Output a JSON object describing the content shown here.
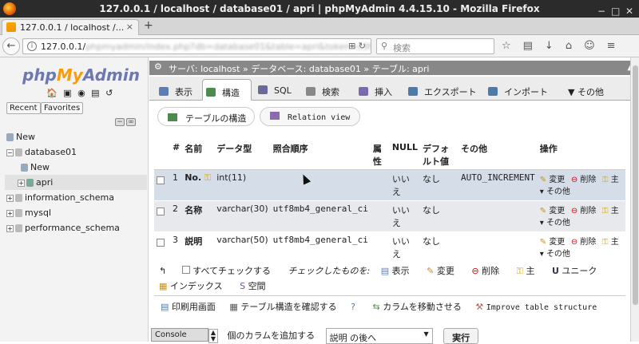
{
  "window": {
    "title": "127.0.0.1 / localhost / database01 / apri | phpMyAdmin 4.4.15.10 - Mozilla Firefox",
    "min": "−",
    "max": "□",
    "close": "✕"
  },
  "browser": {
    "tab_title": "127.0.0.1 / localhost /...",
    "tab_close": "×",
    "new_tab": "+",
    "url_host": "127.0.0.1/",
    "url_rest": "phpmyadmin/index.php?db=database01&table=apri&token=c3f4b1",
    "search_placeholder": "検索",
    "url_icons": "⊞  ↻"
  },
  "sidebar": {
    "logo_php": "php",
    "logo_my": "My",
    "logo_admin": "Admin",
    "icons": "🏠 ▣ ◉ ▤ ↺",
    "recent": "Recent",
    "favorites": "Favorites",
    "tree": [
      {
        "label": "New",
        "level": 0,
        "expander": ""
      },
      {
        "label": "database01",
        "level": 0,
        "expander": "−"
      },
      {
        "label": "New",
        "level": 1,
        "expander": ""
      },
      {
        "label": "apri",
        "level": 1,
        "expander": "+"
      },
      {
        "label": "information_schema",
        "level": 0,
        "expander": "+"
      },
      {
        "label": "mysql",
        "level": 0,
        "expander": "+"
      },
      {
        "label": "performance_schema",
        "level": 0,
        "expander": "+"
      }
    ]
  },
  "breadcrumb": {
    "server": "サーバ: localhost",
    "db": "データベース: database01",
    "table": "テーブル: apri",
    "sep": "»"
  },
  "tabs": [
    {
      "label": "表示",
      "color": "#5b7fb5"
    },
    {
      "label": "構造",
      "color": "#4d8a4d"
    },
    {
      "label": "SQL",
      "color": "#6a6a9a"
    },
    {
      "label": "検索",
      "color": "#777"
    },
    {
      "label": "挿入",
      "color": "#7a6ab0"
    },
    {
      "label": "エクスポート",
      "color": "#4d7aa8"
    },
    {
      "label": "インポート",
      "color": "#4d7aa8"
    },
    {
      "label": "▼ その他",
      "color": ""
    }
  ],
  "subtabs": {
    "structure": "テーブルの構造",
    "relation": "Relation view"
  },
  "table": {
    "headers": [
      "#",
      "名前",
      "データ型",
      "照合順序",
      "属性",
      "NULL",
      "デフォルト値",
      "その他",
      "操作"
    ],
    "rows": [
      {
        "num": "1",
        "name": "No.",
        "key": true,
        "type": "int(11)",
        "collation": "",
        "attr": "",
        "null": "いいえ",
        "default": "なし",
        "extra": "AUTO_INCREMENT"
      },
      {
        "num": "2",
        "name": "名称",
        "key": false,
        "type": "varchar(30)",
        "collation": "utf8mb4_general_ci",
        "attr": "",
        "null": "いいえ",
        "default": "なし",
        "extra": ""
      },
      {
        "num": "3",
        "name": "説明",
        "key": false,
        "type": "varchar(50)",
        "collation": "utf8mb4_general_ci",
        "attr": "",
        "null": "いいえ",
        "default": "なし",
        "extra": ""
      }
    ],
    "actions": {
      "change": "変更",
      "drop": "削除",
      "primary": "主",
      "more": "その他"
    }
  },
  "bulk": {
    "check_all": "すべてチェックする",
    "with_selected": "チェックしたものを:",
    "browse": "表示",
    "change": "変更",
    "drop": "削除",
    "primary": "主",
    "unique": "ユニーク",
    "index": "インデックス",
    "spatial": "空間"
  },
  "footer": {
    "print": "印刷用画面",
    "propose": "テーブル構造を確認する",
    "move": "カラムを移動させる",
    "improve": "Improve table structure"
  },
  "add_columns": {
    "console": "Console",
    "label": "個のカラムを追加する",
    "position": "説明 の後へ",
    "go": "実行"
  }
}
